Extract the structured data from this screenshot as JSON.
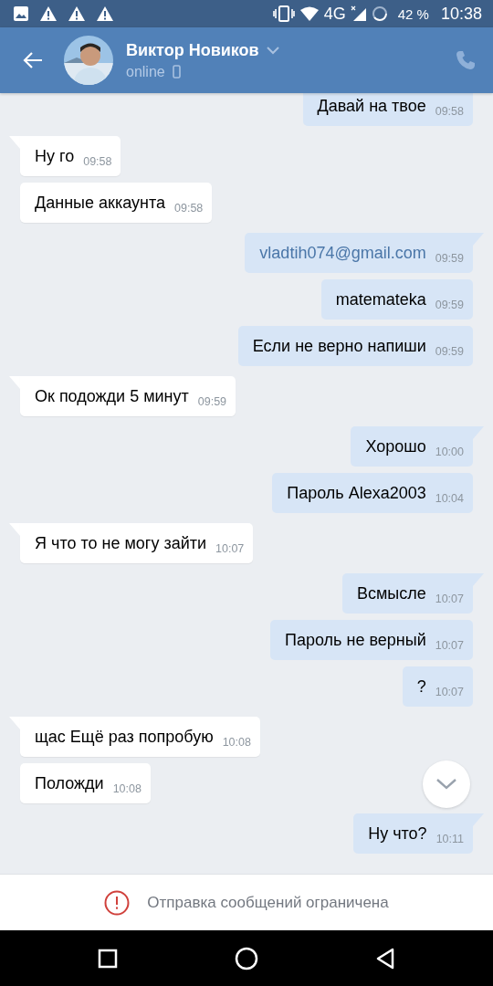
{
  "status_bar": {
    "battery": "42 %",
    "time": "10:38",
    "network": "4G"
  },
  "header": {
    "name": "Виктор Новиков",
    "status": "online"
  },
  "messages": [
    {
      "kind": "outgoing",
      "text": "Давай на твое",
      "time": "09:58",
      "link": false
    },
    {
      "kind": "incoming",
      "text": "Ну го",
      "time": "09:58",
      "link": false
    },
    {
      "kind": "incoming",
      "text": "Данные аккаунта",
      "time": "09:58",
      "link": false
    },
    {
      "kind": "outgoing",
      "text": "vladtih074@gmail.com",
      "time": "09:59",
      "link": true
    },
    {
      "kind": "outgoing",
      "text": "matemateka",
      "time": "09:59",
      "link": false
    },
    {
      "kind": "outgoing",
      "text": "Если не верно напиши",
      "time": "09:59",
      "link": false
    },
    {
      "kind": "incoming",
      "text": "Ок подожди 5 минут",
      "time": "09:59",
      "link": false
    },
    {
      "kind": "outgoing",
      "text": "Хорошо",
      "time": "10:00",
      "link": false
    },
    {
      "kind": "outgoing",
      "text": "Пароль Alexa2003",
      "time": "10:04",
      "link": false
    },
    {
      "kind": "incoming",
      "text": "Я что то не могу зайти",
      "time": "10:07",
      "link": false
    },
    {
      "kind": "outgoing",
      "text": "Всмысле",
      "time": "10:07",
      "link": false
    },
    {
      "kind": "outgoing",
      "text": "Пароль не верный",
      "time": "10:07",
      "link": false
    },
    {
      "kind": "outgoing",
      "text": "?",
      "time": "10:07",
      "link": false
    },
    {
      "kind": "incoming",
      "text": "щас Ещё раз попробую",
      "time": "10:08",
      "link": false
    },
    {
      "kind": "incoming",
      "text": "Положди",
      "time": "10:08",
      "link": false
    },
    {
      "kind": "outgoing",
      "text": "Ну что?",
      "time": "10:11",
      "link": false
    }
  ],
  "footer": {
    "notice": "Отправка сообщений ограничена"
  }
}
